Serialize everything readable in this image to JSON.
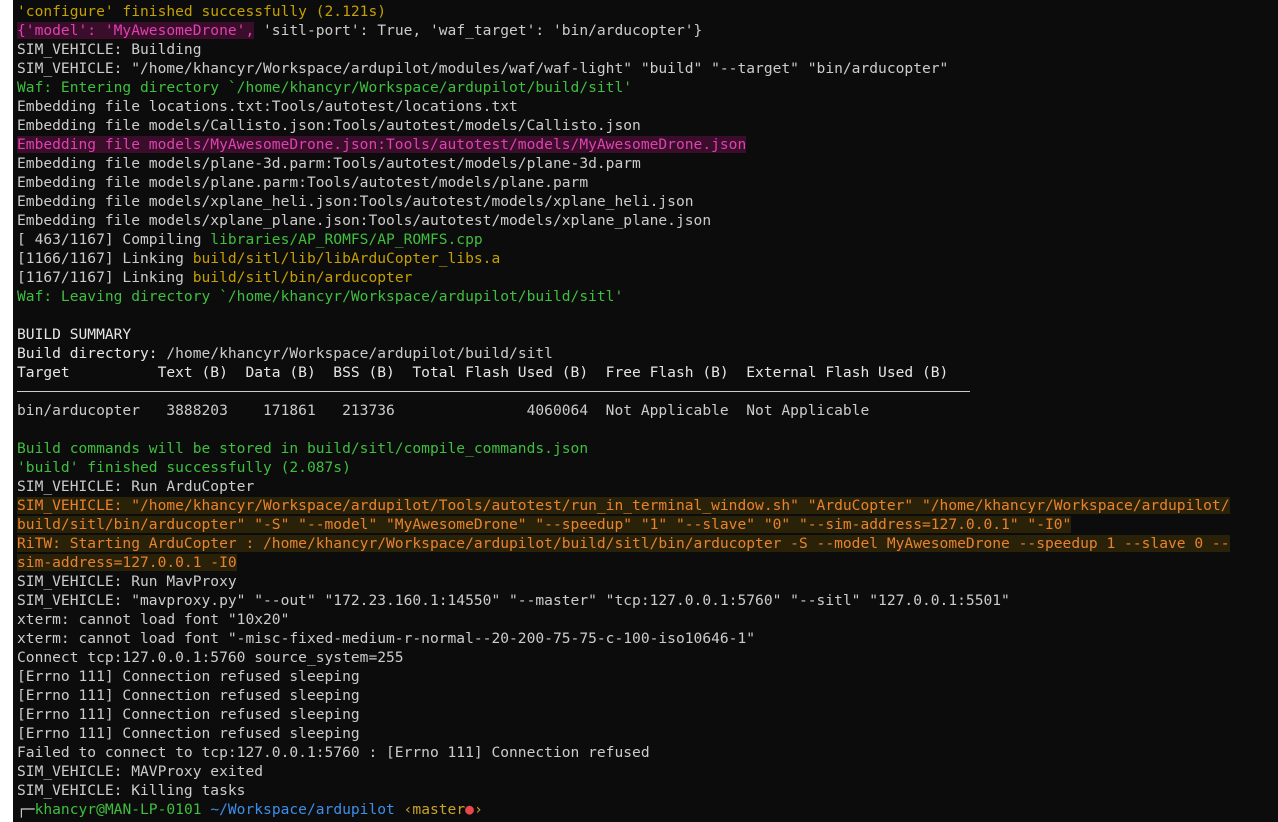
{
  "lines": {
    "l00": "'configure' finished successfully (2.121s)",
    "l01a": "{'model': 'MyAwesomeDrone',",
    "l01b": " 'sitl-port': True, 'waf_target': 'bin/arducopter'}",
    "l02": "SIM_VEHICLE: Building",
    "l03": "SIM_VEHICLE: \"/home/khancyr/Workspace/ardupilot/modules/waf/waf-light\" \"build\" \"--target\" \"bin/arducopter\"",
    "l04": "Waf: Entering directory `/home/khancyr/Workspace/ardupilot/build/sitl'",
    "l05": "Embedding file locations.txt:Tools/autotest/locations.txt",
    "l06": "Embedding file models/Callisto.json:Tools/autotest/models/Callisto.json",
    "l07": "Embedding file models/MyAwesomeDrone.json:Tools/autotest/models/MyAwesomeDrone.json",
    "l08": "Embedding file models/plane-3d.parm:Tools/autotest/models/plane-3d.parm",
    "l09": "Embedding file models/plane.parm:Tools/autotest/models/plane.parm",
    "l10": "Embedding file models/xplane_heli.json:Tools/autotest/models/xplane_heli.json",
    "l11": "Embedding file models/xplane_plane.json:Tools/autotest/models/xplane_plane.json",
    "l12a": "[ 463/1167] Compiling ",
    "l12b": "libraries/AP_ROMFS/AP_ROMFS.cpp",
    "l13a": "[1166/1167] Linking ",
    "l13b": "build/sitl/lib/libArduCopter_libs.a",
    "l14a": "[1167/1167] Linking ",
    "l14b": "build/sitl/bin/arducopter",
    "l15": "Waf: Leaving directory `/home/khancyr/Workspace/ardupilot/build/sitl'",
    "l16": "",
    "l17": "BUILD SUMMARY",
    "l18a": "Build directory: ",
    "l18b": "/home/khancyr/Workspace/ardupilot/build/sitl",
    "l19": "Target          Text (B)  Data (B)  BSS (B)  Total Flash Used (B)  Free Flash (B)  External Flash Used (B)",
    "l21": "bin/arducopter   3888203    171861   213736               4060064  Not Applicable  Not Applicable",
    "l22": "",
    "l23": "Build commands will be stored in build/sitl/compile_commands.json",
    "l24": "'build' finished successfully (2.087s)",
    "l25": "SIM_VEHICLE: Run ArduCopter",
    "l26": "SIM_VEHICLE: \"/home/khancyr/Workspace/ardupilot/Tools/autotest/run_in_terminal_window.sh\" \"ArduCopter\" \"/home/khancyr/Workspace/ardupilot/",
    "l27": "build/sitl/bin/arducopter\" \"-S\" \"--model\" \"MyAwesomeDrone\" \"--speedup\" \"1\" \"--slave\" \"0\" \"--sim-address=127.0.0.1\" \"-I0\"",
    "l28": "RiTW: Starting ArduCopter : /home/khancyr/Workspace/ardupilot/build/sitl/bin/arducopter -S --model MyAwesomeDrone --speedup 1 --slave 0 --",
    "l29": "sim-address=127.0.0.1 -I0",
    "l30": "SIM_VEHICLE: Run MavProxy",
    "l31": "SIM_VEHICLE: \"mavproxy.py\" \"--out\" \"172.23.160.1:14550\" \"--master\" \"tcp:127.0.0.1:5760\" \"--sitl\" \"127.0.0.1:5501\"",
    "l32": "xterm: cannot load font \"10x20\"",
    "l33": "xterm: cannot load font \"-misc-fixed-medium-r-normal--20-200-75-75-c-100-iso10646-1\"",
    "l34": "Connect tcp:127.0.0.1:5760 source_system=255",
    "l35": "[Errno 111] Connection refused sleeping",
    "l36": "[Errno 111] Connection refused sleeping",
    "l37": "[Errno 111] Connection refused sleeping",
    "l38": "[Errno 111] Connection refused sleeping",
    "l39": "Failed to connect to tcp:127.0.0.1:5760 : [Errno 111] Connection refused",
    "l40": "SIM_VEHICLE: MAVProxy exited",
    "l41": "SIM_VEHICLE: Killing tasks"
  },
  "prompt": {
    "corner": "┌─",
    "userhost": "khancyr@MAN-LP-0101",
    "path": "~/Workspace/ardupilot",
    "branch_open": "‹master",
    "dirty_dot": "●",
    "branch_close": "›"
  },
  "colors": {
    "background": "#0c0c0c",
    "text": "#cccccc",
    "green": "#3fbf3f",
    "yellow": "#c4a000",
    "orange": "#e8822e",
    "magenta": "#e040b0",
    "blue": "#3b8eea"
  }
}
